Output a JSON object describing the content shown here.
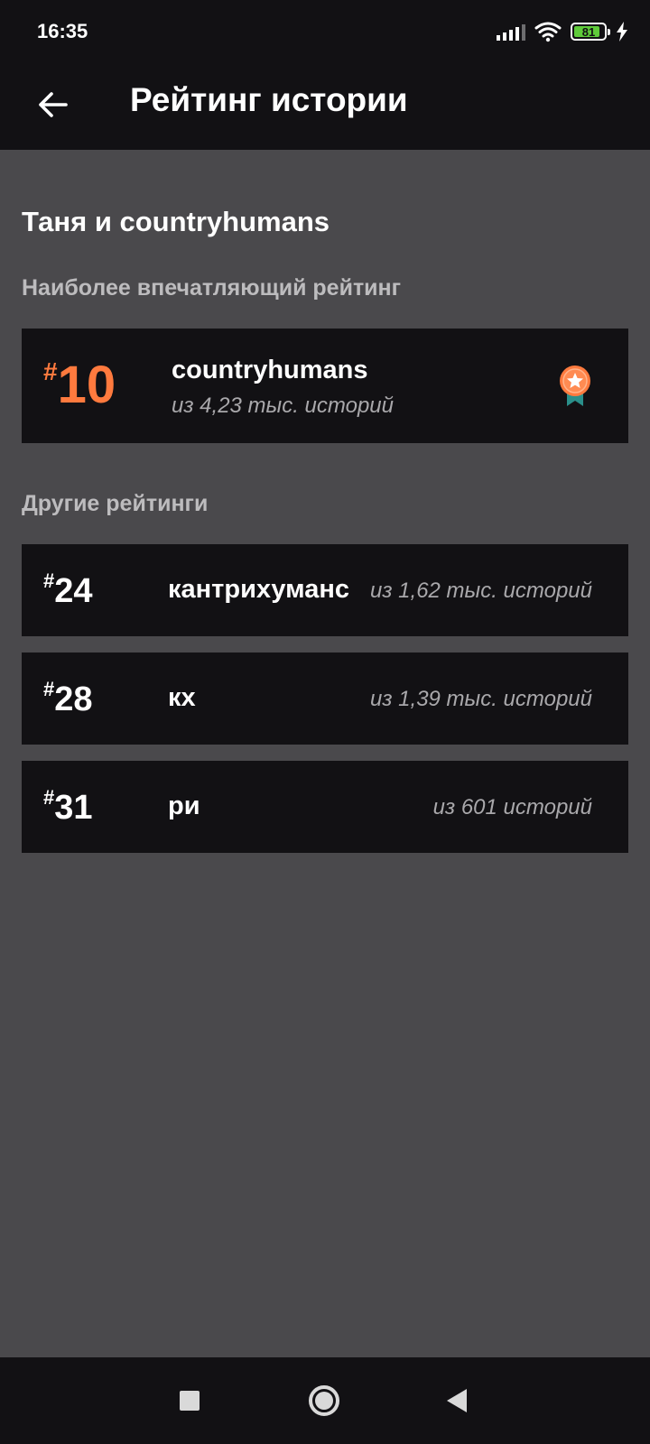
{
  "status_bar": {
    "time": "16:35",
    "battery_level": "81",
    "icons": [
      "signal-icon",
      "wifi-icon",
      "battery-icon",
      "charging-icon"
    ]
  },
  "header": {
    "title": "Рейтинг истории",
    "back_icon": "arrow-left-icon"
  },
  "story": {
    "title": "Таня и countryhumans"
  },
  "best_ranking": {
    "section_label": "Наиболее впечатляющий рейтинг",
    "hash": "#",
    "rank": "10",
    "tag": "countryhumans",
    "count": "из 4,23 тыс. историй",
    "icon": "medal-icon",
    "accent_color": "#ff7a3e"
  },
  "other_rankings": {
    "section_label": "Другие рейтинги",
    "items": [
      {
        "hash": "#",
        "rank": "24",
        "tag": "кантрихуманс",
        "count": "из 1,62 тыс. историй"
      },
      {
        "hash": "#",
        "rank": "28",
        "tag": "кх",
        "count": "из 1,39 тыс. историй"
      },
      {
        "hash": "#",
        "rank": "31",
        "tag": "ри",
        "count": "из 601 историй"
      }
    ]
  },
  "nav_bar": {
    "buttons": [
      "recents-square-icon",
      "home-circle-icon",
      "back-triangle-icon"
    ]
  },
  "colors": {
    "background": "#4a494c",
    "card": "#121114",
    "accent": "#ff7a3e",
    "muted_text": "#a9a8ab"
  }
}
